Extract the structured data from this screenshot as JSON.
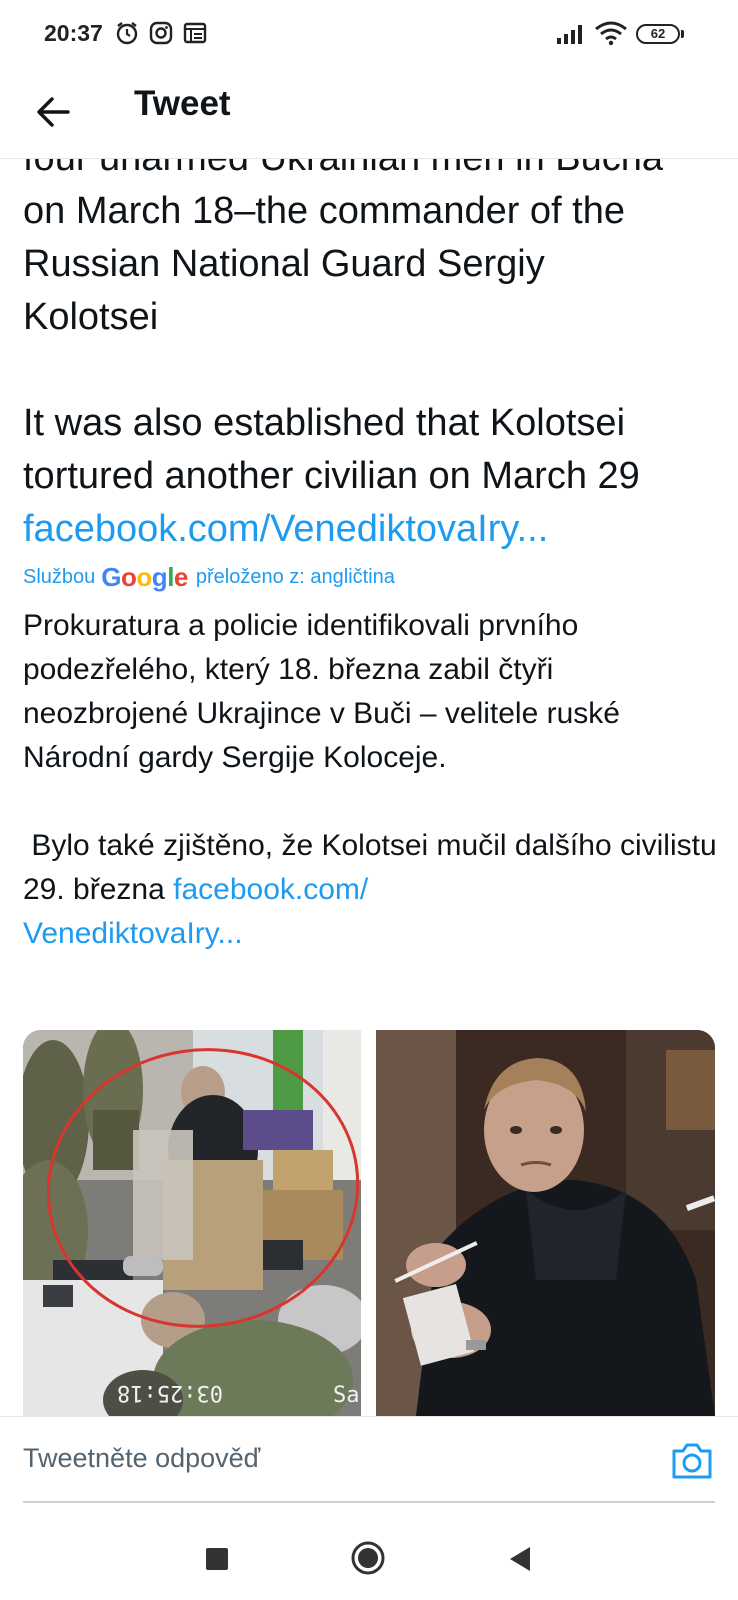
{
  "status_bar": {
    "time": "20:37",
    "battery": "62",
    "icons": [
      "alarm-icon",
      "instagram-icon",
      "calendar-icon",
      "signal-icon",
      "wifi-icon",
      "battery-icon"
    ]
  },
  "header": {
    "back_icon": "arrow-left-icon",
    "title": "Tweet"
  },
  "tweet": {
    "partial_line": "four unarmed Ukrainian men in Bucha",
    "line1": "on March 18–the commander of the",
    "line2": "Russian National Guard Sergiy",
    "line3": "Kolotsei",
    "para2": "It was also established that Kolotsei tortured another civilian on March 29",
    "link": "facebook.com/VenediktovaIry..."
  },
  "translation": {
    "prefix": "Službou",
    "brand": "Google",
    "suffix": "přeloženo z: angličtina",
    "para1": "Prokuratura a policie identifikovali prvního podezřelého, který 18. března zabil čtyři neozbrojené Ukrajince v Buči – velitele ruské Národní gardy Sergije Koloceje.",
    "para2": " Bylo také zjištěno, že Kolotsei mučil dalšího civilistu 29. března",
    "link_part1": "facebook.com/",
    "link_part2": "VenediktovaIry..."
  },
  "media": {
    "left_timestamp": "03:25:18",
    "left_label": "Sat"
  },
  "reply": {
    "placeholder": "Tweetněte odpověď",
    "camera_icon": "camera-icon"
  },
  "nav": {
    "icons": [
      "recents-square-icon",
      "home-circle-icon",
      "back-triangle-icon"
    ]
  },
  "colors": {
    "accent": "#1d9bf0",
    "text": "#0f1419",
    "secondary": "#536471",
    "background": "#ffffff"
  }
}
